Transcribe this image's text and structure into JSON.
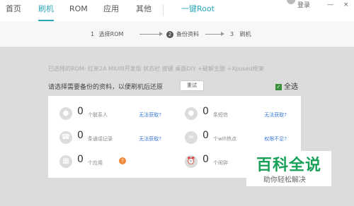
{
  "nav": {
    "items": [
      "首页",
      "刷机",
      "ROM",
      "应用",
      "其他"
    ],
    "one_click_root": "一键Root",
    "login": "登录"
  },
  "window_controls": {
    "minimize": "—",
    "close": "×"
  },
  "steps": [
    {
      "num": "1",
      "label": "选择ROM"
    },
    {
      "num": "2",
      "label": "备份资料"
    },
    {
      "num": "3",
      "label": "刷机"
    }
  ],
  "selected_rom": "已选择的ROM:  红米2A MIUI8开发版 状态栏 按键 桌面DIY +破解主题 +Xposed框架",
  "instruction": "请选择需要备份的资料，以便刷机后还原",
  "reset_button": "重试",
  "select_all": "全选",
  "items": [
    {
      "icon": "contacts-icon",
      "count": "0",
      "label": "个联系人",
      "link": "无法获取?"
    },
    {
      "icon": "sms-icon",
      "count": "0",
      "label": "条短信",
      "link": "无法获取?"
    },
    {
      "icon": "call-log-icon",
      "count": "0",
      "label": "条通话记录",
      "link": "无法获取?"
    },
    {
      "icon": "wifi-icon",
      "count": "0",
      "label": "个wifi热点",
      "link": "权限不足?"
    },
    {
      "icon": "apps-icon",
      "count": "0",
      "label": "个应用",
      "link": ""
    },
    {
      "icon": "alarm-icon",
      "count": "0",
      "label": "个闹钟",
      "link": ""
    }
  ],
  "watermark": {
    "title": "百科全说",
    "subtitle": "助你轻松解决"
  },
  "colors": {
    "accent": "#2aa7b8",
    "link": "#3c7bd6",
    "checkbox": "#3a8f3a",
    "watermark": "#18a058"
  }
}
